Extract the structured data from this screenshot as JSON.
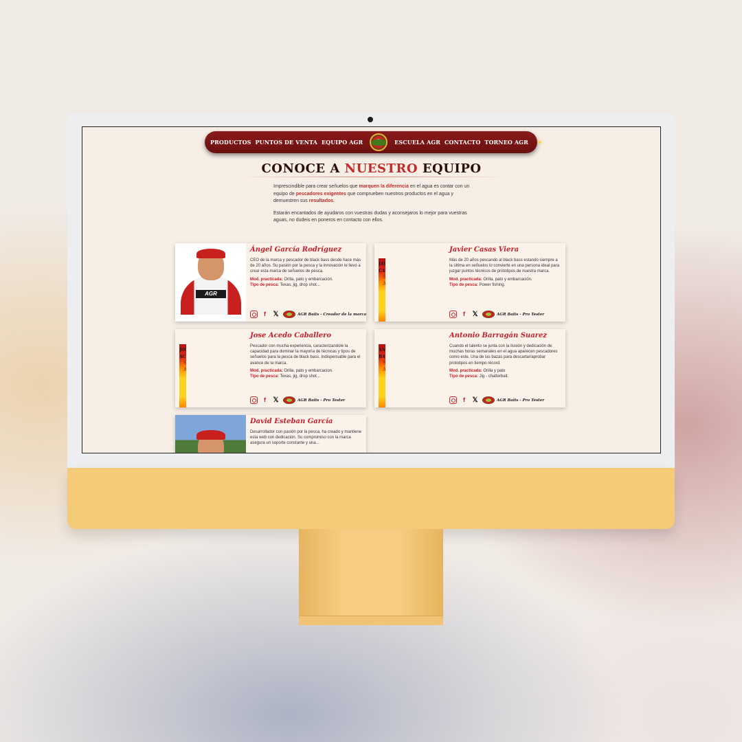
{
  "nav": {
    "links_left": [
      "PRODUCTOS",
      "PUNTOS DE VENTA",
      "EQUIPO AGR"
    ],
    "links_right": [
      "ESCUELA AGR",
      "CONTACTO",
      "TORNEO AGR"
    ]
  },
  "heading": {
    "part1": "CONOCE A ",
    "part2": "NUESTRO",
    "part3": " EQUIPO"
  },
  "intro": {
    "p1": [
      "Imprescindible para crear señuelos que ",
      "marquen la diferencia",
      " en el agua es contar con un equipo de ",
      "pescadores exigentes",
      " que comprueben nuestros productos en el agua y demuestren sus ",
      "resultados",
      "."
    ],
    "p2": "Estarán encantados de ayudaros con vuestras dudas y aconsejaros lo mejor para vuestras aguas, no dudeis en poneros en contacto con ellos."
  },
  "labels": {
    "mod": "Mod. practicada:",
    "tipo": "Tipo de pesca:"
  },
  "photo_overlay": {
    "staff": "STAFF AGR",
    "shirt": "AGR"
  },
  "members": [
    {
      "name": "Ángel García Rodríguez",
      "description": "CEO de la marca y pescador de black bass desde hace más de 20 años. Su pasión por la pesca y la innovación le llevó a crear esta marca de señuelos de pesca.",
      "mod": "Orilla, pato y embarcación.",
      "tipo": "Texas, jig, drop shot...",
      "role": "AGR Baits - Creador de la marca",
      "photo_caption": "",
      "photo_style": "white"
    },
    {
      "name": "Javier Casas Viera",
      "description": "Más de 20 años pescando al black bass estando siempre a la última en señuelos lo convierte en una persona ideal para juzgar puntos técnicos de prototipos de nuestra marca.",
      "mod": "Orilla, pato y embarcación.",
      "tipo": "Power fishing.",
      "role": "AGR Baits - Pro Tester",
      "photo_caption": "JAVIER CASAS",
      "photo_style": "staff"
    },
    {
      "name": "Jose Acedo Caballero",
      "description": "Pescador con mucha experiencia, caracterizandole la capacidad para dominar la mayoría de técnicas y tipos de señuelos para la pesca de black bass. Indispensable para el avance de la marca.",
      "mod": "Orilla, pato y embarcacion.",
      "tipo": "Texas, jig, drop shot...",
      "role": "AGR Baits - Pro Tester",
      "photo_caption": "JOSE ACEDO",
      "photo_style": "staff"
    },
    {
      "name": "Antonio Barragán Suarez",
      "description": "Cuando el talento se junta con la ilusión y dedicación de muchas horas semanales en el agua aparecen pescadores como este. Una de las bazas para descartar/aprobar prototipos en tiempo récord.",
      "mod": "Orilla y pato",
      "tipo": "Jig - chatterbait.",
      "role": "AGR Baits - Pro Tester",
      "photo_caption": "ANTONIO BARRAGAN",
      "photo_style": "staff"
    },
    {
      "name": "David Esteban García",
      "description": "Desarrollador con pasión por la pesca, ha creado y mantiene esta web con dedicación. Su compromiso con la marca asegura un soporte constante y una...",
      "mod": "",
      "tipo": "",
      "role": "",
      "photo_caption": "",
      "photo_style": "lake"
    }
  ],
  "colors": {
    "nav_bg": "#7a1414",
    "accent_red": "#c8202a",
    "page_bg": "#f7efe6",
    "imac_chin": "#f5ca78",
    "bezel": "#eceef0"
  },
  "icons": [
    "instagram-icon",
    "facebook-icon",
    "x-icon",
    "agr-logo-icon",
    "spain-flag-icon",
    "sun-icon"
  ]
}
